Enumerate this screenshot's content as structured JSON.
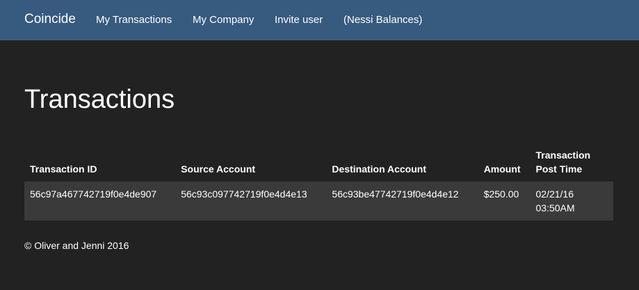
{
  "navbar": {
    "brand": "Coincide",
    "links": [
      "My Transactions",
      "My Company",
      "Invite user",
      "(Nessi Balances)"
    ]
  },
  "page": {
    "title": "Transactions"
  },
  "table": {
    "columns": [
      "Transaction ID",
      "Source Account",
      "Destination Account",
      "Amount",
      "Transaction Post Time"
    ],
    "rows": [
      {
        "transaction_id": "56c97a467742719f0e4de907",
        "source_account": "56c93c097742719f0e4d4e13",
        "destination_account": "56c93be47742719f0e4d4e12",
        "amount": "$250.00",
        "post_time": "02/21/16 03:50AM"
      }
    ]
  },
  "footer": {
    "text": "© Oliver and Jenni 2016"
  },
  "colors": {
    "navbar_bg": "#375a7f",
    "page_bg": "#222222",
    "row_bg": "#3a3a3a"
  }
}
